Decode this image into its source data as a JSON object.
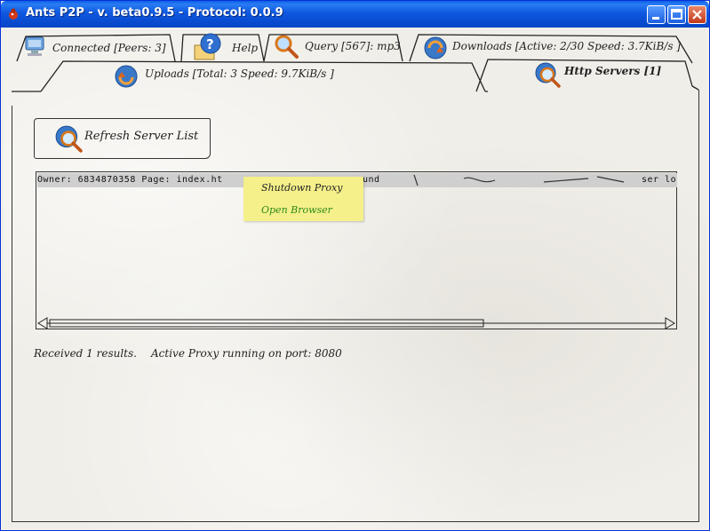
{
  "window": {
    "title": "Ants P2P - v. beta0.9.5 - Protocol: 0.0.9",
    "controls": {
      "minimize": "minimize",
      "maximize": "maximize",
      "close": "close"
    }
  },
  "tabs_row1": [
    {
      "label": "Connected [Peers: 3]",
      "icon": "computer-icon"
    },
    {
      "label": "Help",
      "icon": "help-icon"
    },
    {
      "label": "Query [567]: mp3",
      "icon": "magnifier-icon"
    },
    {
      "label": "Downloads [Active: 2/30 Speed: 3.7KiB/s ]",
      "icon": "download-icon"
    }
  ],
  "tabs_row2": [
    {
      "label": "Uploads [Total: 3 Speed: 9.7KiB/s ]",
      "icon": "upload-icon"
    },
    {
      "label": "Http Servers [1]",
      "icon": "server-icon",
      "selected": true
    }
  ],
  "toolbar": {
    "refresh_label": "Refresh Server List"
  },
  "server_list": {
    "rows": [
      {
        "text": "Owner: 6834870358   Page: index.ht",
        "text_tail": "und"
      }
    ],
    "tail_text": "ser lo"
  },
  "context_menu": {
    "items": [
      "Shutdown Proxy",
      "Open Browser"
    ]
  },
  "status": {
    "received": "Received 1 results.",
    "proxy": "Active Proxy running on port: 8080"
  },
  "colors": {
    "titlebar": "#0a4fd4",
    "menu_bg": "#f5f08a",
    "selected_row": "#cfcfcf",
    "open_browser_text": "#2e8b1a"
  }
}
